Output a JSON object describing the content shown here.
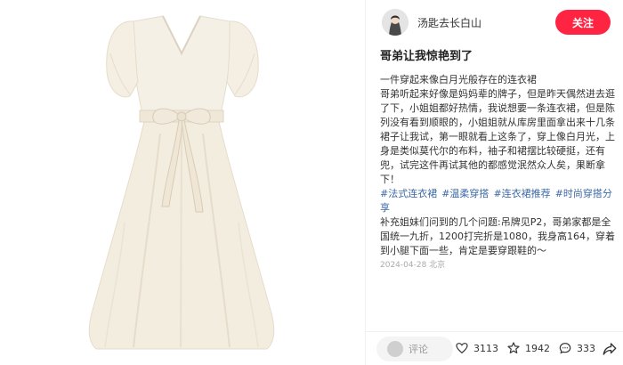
{
  "author": {
    "name": "汤匙去长白山",
    "follow_label": "关注"
  },
  "post": {
    "title": "哥弟让我惊艳到了",
    "paragraphs": [
      "一件穿起来像白月光般存在的连衣裙",
      "哥弟听起来好像是妈妈辈的牌子，但是昨天偶然进去逛了下，小姐姐都好热情，我说想要一条连衣裙，但是陈列没有看到顺眼的，小姐姐就从库房里面拿出来十几条裙子让我试，第一眼就看上这条了，穿上像白月光，上身是类似莫代尔的布料，袖子和裙摆比较硬挺，还有兜，试完这件再试其他的都感觉泯然众人矣，果断拿下！"
    ],
    "tags": [
      "#法式连衣裙",
      "#温柔穿搭",
      "#连衣裙推荐",
      "#时尚穿搭分享"
    ],
    "supplement": "补充姐妹们问到的几个问题:吊牌见P2，哥弟家都是全国统一九折，1200打完折是1080，我身高164，穿着到小腿下面一些，肯定是要穿跟鞋的～",
    "date": "2024-04-28 北京"
  },
  "bottom_bar": {
    "comment_placeholder": "评论",
    "likes": "3113",
    "favorites": "1942",
    "comments": "333"
  }
}
